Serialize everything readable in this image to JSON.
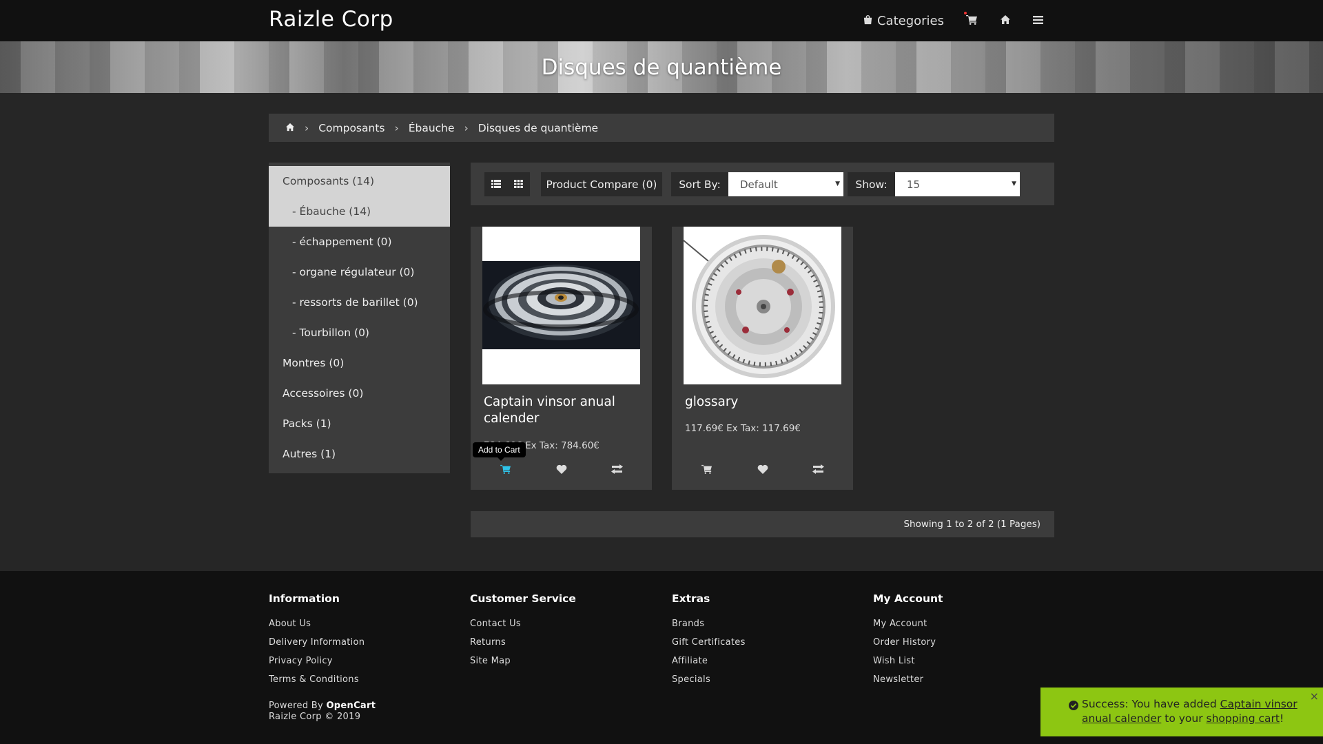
{
  "header": {
    "brand": "Raizle Corp",
    "categories_label": "Categories"
  },
  "hero": {
    "title": "Disques de quantième"
  },
  "breadcrumb": {
    "items": [
      "Composants",
      "Ébauche",
      "Disques de quantième"
    ]
  },
  "sidebar": {
    "items": [
      {
        "label": "Composants (14)"
      },
      {
        "label": "- Ébauche (14)"
      },
      {
        "label": "- échappement (0)"
      },
      {
        "label": "- organe régulateur (0)"
      },
      {
        "label": "- ressorts de barillet (0)"
      },
      {
        "label": "- Tourbillon (0)"
      },
      {
        "label": "Montres (0)"
      },
      {
        "label": "Accessoires (0)"
      },
      {
        "label": "Packs (1)"
      },
      {
        "label": "Autres (1)"
      }
    ]
  },
  "toolbar": {
    "compare_label": "Product Compare (0)",
    "sort_label": "Sort By:",
    "sort_value": "Default",
    "show_label": "Show:",
    "show_value": "15"
  },
  "products": [
    {
      "name": "Captain vinsor anual calender",
      "price": "784.60€ Ex Tax: 784.60€",
      "tooltip": "Add to Cart"
    },
    {
      "name": "glossary",
      "price": "117.69€ Ex Tax: 117.69€"
    }
  ],
  "results_text": "Showing 1 to 2 of 2 (1 Pages)",
  "footer": {
    "columns": [
      {
        "title": "Information",
        "links": [
          "About Us",
          "Delivery Information",
          "Privacy Policy",
          "Terms & Conditions"
        ]
      },
      {
        "title": "Customer Service",
        "links": [
          "Contact Us",
          "Returns",
          "Site Map"
        ]
      },
      {
        "title": "Extras",
        "links": [
          "Brands",
          "Gift Certificates",
          "Affiliate",
          "Specials"
        ]
      },
      {
        "title": "My Account",
        "links": [
          "My Account",
          "Order History",
          "Wish List",
          "Newsletter"
        ]
      }
    ],
    "powered_prefix": "Powered By",
    "powered_link": "OpenCart",
    "copyright": "Raizle Corp © 2019"
  },
  "alert": {
    "prefix": "Success: You have added",
    "product_link": "Captain vinsor anual calender",
    "middle": "to your",
    "cart_link": "shopping cart",
    "suffix": "!",
    "close": "×"
  },
  "colors": {
    "accent_alert": "#8dc612",
    "highlight_icon": "#2ec4ea"
  },
  "icons": [
    "shopping-bag-icon",
    "cart-icon",
    "home-icon",
    "menu-icon",
    "list-view-icon",
    "grid-view-icon",
    "heart-icon",
    "compare-icon",
    "check-circle-icon"
  ]
}
